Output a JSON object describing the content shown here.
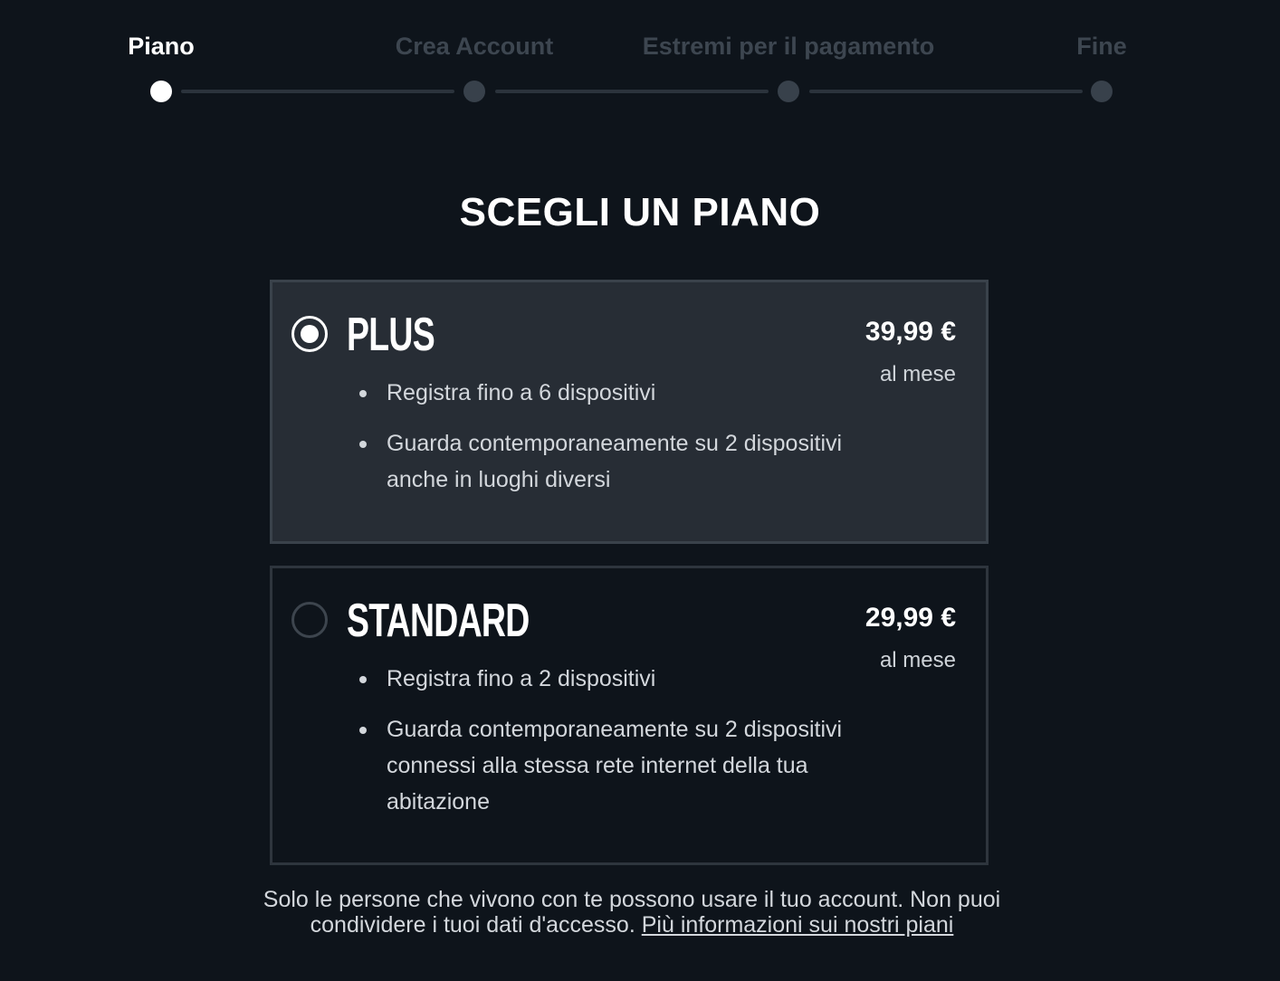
{
  "stepper": {
    "steps": [
      {
        "label": "Piano",
        "active": true
      },
      {
        "label": "Crea Account",
        "active": false
      },
      {
        "label": "Estremi per il pagamento",
        "active": false
      },
      {
        "label": "Fine",
        "active": false
      }
    ]
  },
  "title": "SCEGLI UN PIANO",
  "plans": [
    {
      "name": "PLUS",
      "selected": true,
      "price": "39,99 €",
      "period": "al mese",
      "features": [
        "Registra fino a 6 dispositivi",
        "Guarda contemporaneamente su 2 dispositivi anche in luoghi diversi"
      ]
    },
    {
      "name": "STANDARD",
      "selected": false,
      "price": "29,99 €",
      "period": "al mese",
      "features": [
        "Registra fino a 2 dispositivi",
        "Guarda contemporaneamente su 2 dispositivi connessi alla stessa rete internet della tua abitazione"
      ]
    }
  ],
  "footnote": {
    "text": "Solo le persone che vivono con te possono usare il tuo account. Non puoi condividere i tuoi dati d'accesso. ",
    "link": "Più informazioni sui nostri piani"
  },
  "colors": {
    "background": "#0e141b",
    "card_selected": "#272d35",
    "inactive_step": "#3d4650"
  }
}
